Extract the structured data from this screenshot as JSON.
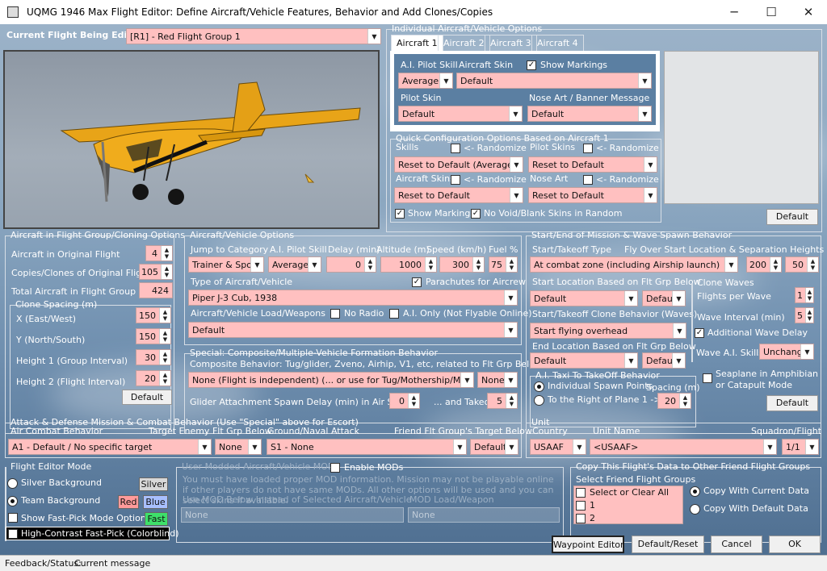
{
  "window": {
    "title": "UQMG 1946 Max Flight Editor:  Define Aircraft/Vehicle Features, Behavior and Add Clones/Copies",
    "minimize": "─",
    "maximize": "☐",
    "close": "✕"
  },
  "current_flight": {
    "label": "Current Flight Being Edited:",
    "value": "[R1] -  Red Flight Group  1"
  },
  "individual": {
    "title": "Individual Aircraft/Vehicle Options",
    "tabs": [
      "Aircraft 1",
      "Aircraft 2",
      "Aircraft 3",
      "Aircraft 4"
    ],
    "ai_pilot_skill_label": "A.I. Pilot Skill",
    "ai_pilot_skill": "Average",
    "aircraft_skin_label": "Aircraft Skin",
    "aircraft_skin": "Default",
    "show_markings_label": "Show Markings",
    "pilot_skin_label": "Pilot Skin",
    "pilot_skin": "Default",
    "nose_art_label": "Nose Art / Banner Message",
    "nose_art": "Default",
    "default_button": "Default"
  },
  "quick": {
    "title": "Quick Configuration Options Based on Aircraft 1",
    "skills_label": "Skills",
    "randomize": "<- Randomize",
    "skills_value": "Reset to Default (Average)",
    "pilot_skins_label": "Pilot Skins",
    "pilot_skins_value": "Reset to Default",
    "aircraft_skins_label": "Aircraft Skins",
    "aircraft_skins_value": "Reset to Default",
    "nose_art_label": "Nose Art",
    "nose_art_value": "Reset to Default",
    "show_markings_label": "Show Markings",
    "no_void_label": "No Void/Blank Skins in Random"
  },
  "cloning": {
    "title": "Aircraft in Flight Group/Cloning Options",
    "in_original_label": "Aircraft in Original Flight",
    "in_original": "4",
    "copies_label": "Copies/Clones of Original Flight",
    "copies": "105",
    "total_label": "Total Aircraft in Flight Group",
    "total": "424",
    "spacing_title": "Clone Spacing (m)",
    "x_label": "X (East/West)",
    "x": "150",
    "y_label": "Y (North/South)",
    "y": "150",
    "h1_label": "Height 1 (Group Interval)",
    "h1": "30",
    "h2_label": "Height 2 (Flight Interval)",
    "h2": "20",
    "default_button": "Default"
  },
  "vehicle": {
    "title": "Aircraft/Vehicle Options",
    "jump_label": "Jump to Category",
    "jump": "Trainer & Sport",
    "skill_label": "A.I. Pilot Skill",
    "skill": "Average",
    "delay_label": "Delay (min)",
    "delay": "0",
    "altitude_label": "Altitude (m)",
    "altitude": "1000",
    "speed_label": "Speed (km/h)",
    "speed": "300",
    "fuel_label": "Fuel %",
    "fuel": "75",
    "type_label": "Type of Aircraft/Vehicle",
    "type": "Piper J-3 Cub, 1938",
    "parachutes_label": "Parachutes for Aircrew",
    "load_label": "Aircraft/Vehicle Load/Weapons",
    "load": "Default",
    "no_radio_label": "No Radio",
    "ai_only_label": "A.I. Only (Not Flyable Online)"
  },
  "special": {
    "title": "Special: Composite/Multiple-Vehicle Formation Behavior",
    "behavior_label": "Composite Behavior: Tug/glider, Zveno, Airhip, V1, etc, related to Flt Grp Below",
    "behavior": "None (Flight is independent) (... or use for Tug/Mothership/Mistel Bomb)",
    "behavior2": "None",
    "glider_label": "Glider Attachment Spawn Delay (min) in Air Start",
    "glider": "0",
    "takeoff_label": "... and Takeoff",
    "takeoff": "5"
  },
  "spawn": {
    "title": "Start/End of Mission & Wave Spawn Behavior",
    "type_label": "Start/Takeoff Type",
    "fly_over_label": "Fly Over Start Location & Separation Heights (m)",
    "type": "At combat zone (including Airship launch)",
    "h1": "200",
    "h2": "50",
    "start_loc_label": "Start Location Based on Flt Grp Below",
    "start_loc": "Default",
    "start_loc2": "Default",
    "clone_beh_label": "Start/Takeoff Clone Behavior (Waves)",
    "clone_beh": "Start flying overhead",
    "end_loc_label": "End Location Based on Flt Grp Below",
    "end_loc": "Default",
    "end_loc2": "Default",
    "waves_title": "Clone Waves",
    "fpw_label": "Flights per Wave",
    "fpw": "1",
    "wi_label": "Wave Interval (min)",
    "wi": "5",
    "awd_label": "Additional Wave Delay",
    "wave_ai_label": "Wave A.I. Skills",
    "wave_ai": "Unchanged",
    "taxi_title": "A.I. Taxi To TakeOff Behavior",
    "ind_label": "Individual Spawn Points",
    "spacing_label": "Spacing (m)",
    "right_label": "To the Right of Plane 1 ->",
    "spacing": "20",
    "seaplane_label": "Seaplane in Amphibian or Catapult Mode",
    "default_button": "Default"
  },
  "attack": {
    "title": "Attack & Defense Mission & Combat Behavior (Use \"Special\" above for Escort)",
    "air_label": "Air Combat Behavior",
    "air": "A1 - Default / No specific target",
    "target_label": "Target Enemy Flt Grp Below",
    "target": "None",
    "ground_label": "Ground/Naval Attack",
    "ground": "S1 - None",
    "friend_label": "Friend Flt Group's Target Below",
    "friend": "Default"
  },
  "unit": {
    "title": "Unit",
    "country_label": "Country",
    "country": "USAAF",
    "name_label": "Unit Name",
    "name": "<USAAF>",
    "sq_label": "Squadron/Flight",
    "sq": "1/1"
  },
  "mode": {
    "title": "Flight Editor Mode",
    "silver_label": "Silver Background",
    "silver_tag": "Silver",
    "team_label": "Team Background",
    "red_tag": "Red",
    "blue_tag": "Blue",
    "fast_label": "Show Fast-Pick Mode Options",
    "fast_tag": "Fast",
    "hc_label": "High-Contrast Fast-Pick (Colorblind)"
  },
  "mods": {
    "title": "User Modded Aircraft/Vehicle MODs",
    "enable_label": "Enable MODs",
    "note": "You must have loaded proper MOD information. Mission may not be playable online if other players do not have same MODs. All other options will be used and you can select skins if available.",
    "use_label": "Use MOD Below Instead of Selected Aircraft/Vehicle",
    "load_label": "MOD Load/Weapon",
    "mod": "None",
    "load": "None"
  },
  "copy": {
    "title": "Copy This Flight's Data to Other Friend Flight Groups",
    "select_label": "Select Friend Flight Groups",
    "items": [
      "Select or Clear All",
      "1",
      "2"
    ],
    "current_label": "Copy With Current Data",
    "default_label": "Copy With Default Data"
  },
  "buttons": {
    "waypoint": "Waypoint Editor",
    "reset": "Default/Reset",
    "cancel": "Cancel",
    "ok": "OK"
  },
  "status": {
    "label": "Feedback/Status:",
    "message": "Current message"
  },
  "colors": {
    "field": "#ffc0c0",
    "red_tag": "#ff9a9a",
    "blue_tag": "#a8bfff",
    "fast_tag": "#3ee06a",
    "silver_tag": "#d8d8d8",
    "plane": "#f0a818"
  }
}
